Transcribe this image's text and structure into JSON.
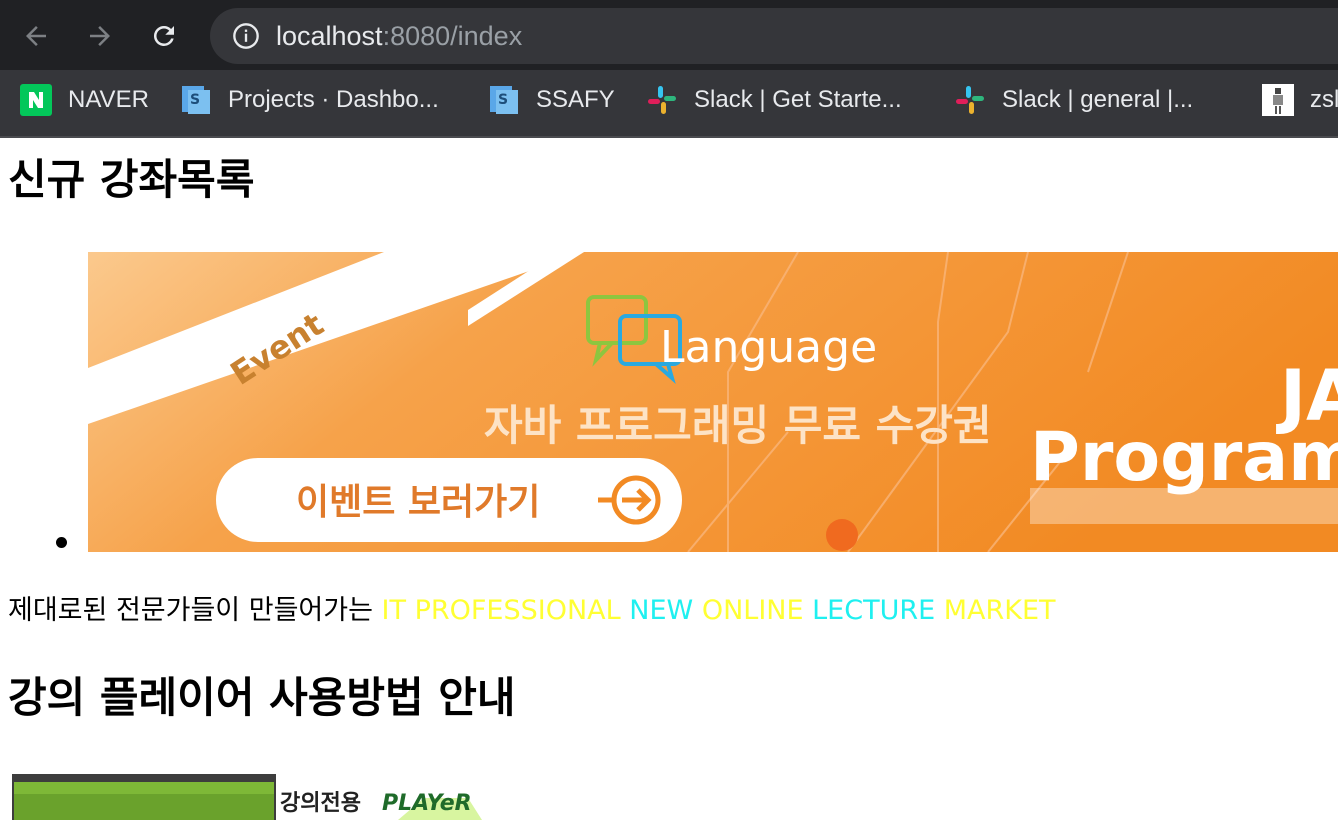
{
  "browser": {
    "url_host": "localhost",
    "url_path": ":8080/index",
    "bookmarks": [
      {
        "label": "NAVER",
        "icon": "naver-icon"
      },
      {
        "label": "Projects · Dashbo...",
        "icon": "gitlab-s-icon"
      },
      {
        "label": "SSAFY",
        "icon": "gitlab-s-icon"
      },
      {
        "label": "Slack | Get Starte...",
        "icon": "slack-icon"
      },
      {
        "label": "Slack | general |...",
        "icon": "slack-icon"
      },
      {
        "label": "zsl",
        "icon": "page-icon"
      }
    ]
  },
  "page": {
    "new_courses_heading": "신규 강좌목록",
    "banner": {
      "ribbon": "Event",
      "logo_text": "Language",
      "subtitle": "자바 프로그래밍 무료 수강권",
      "button": "이벤트 보러가기",
      "side_big_top": "JA",
      "side_big": "Program"
    },
    "tagline": {
      "prefix": "제대로된 전문가들이 만들어가는 ",
      "w1": "IT",
      "w2": "PROFESSIONAL",
      "w3": "NEW",
      "w4": "ONLINE",
      "w5": "LECTURE",
      "w6": "MARKET"
    },
    "player_heading": "강의 플레이어 사용방법 안내",
    "player_image": {
      "korean": "강의전용",
      "english": "PLAYeR"
    }
  },
  "colors": {
    "chrome_dark": "#202124",
    "chrome_toolbar": "#35363a",
    "banner_orange": "#f4922f",
    "tagline_yellow": "#ffff33",
    "tagline_cyan": "#1ff0f0"
  }
}
